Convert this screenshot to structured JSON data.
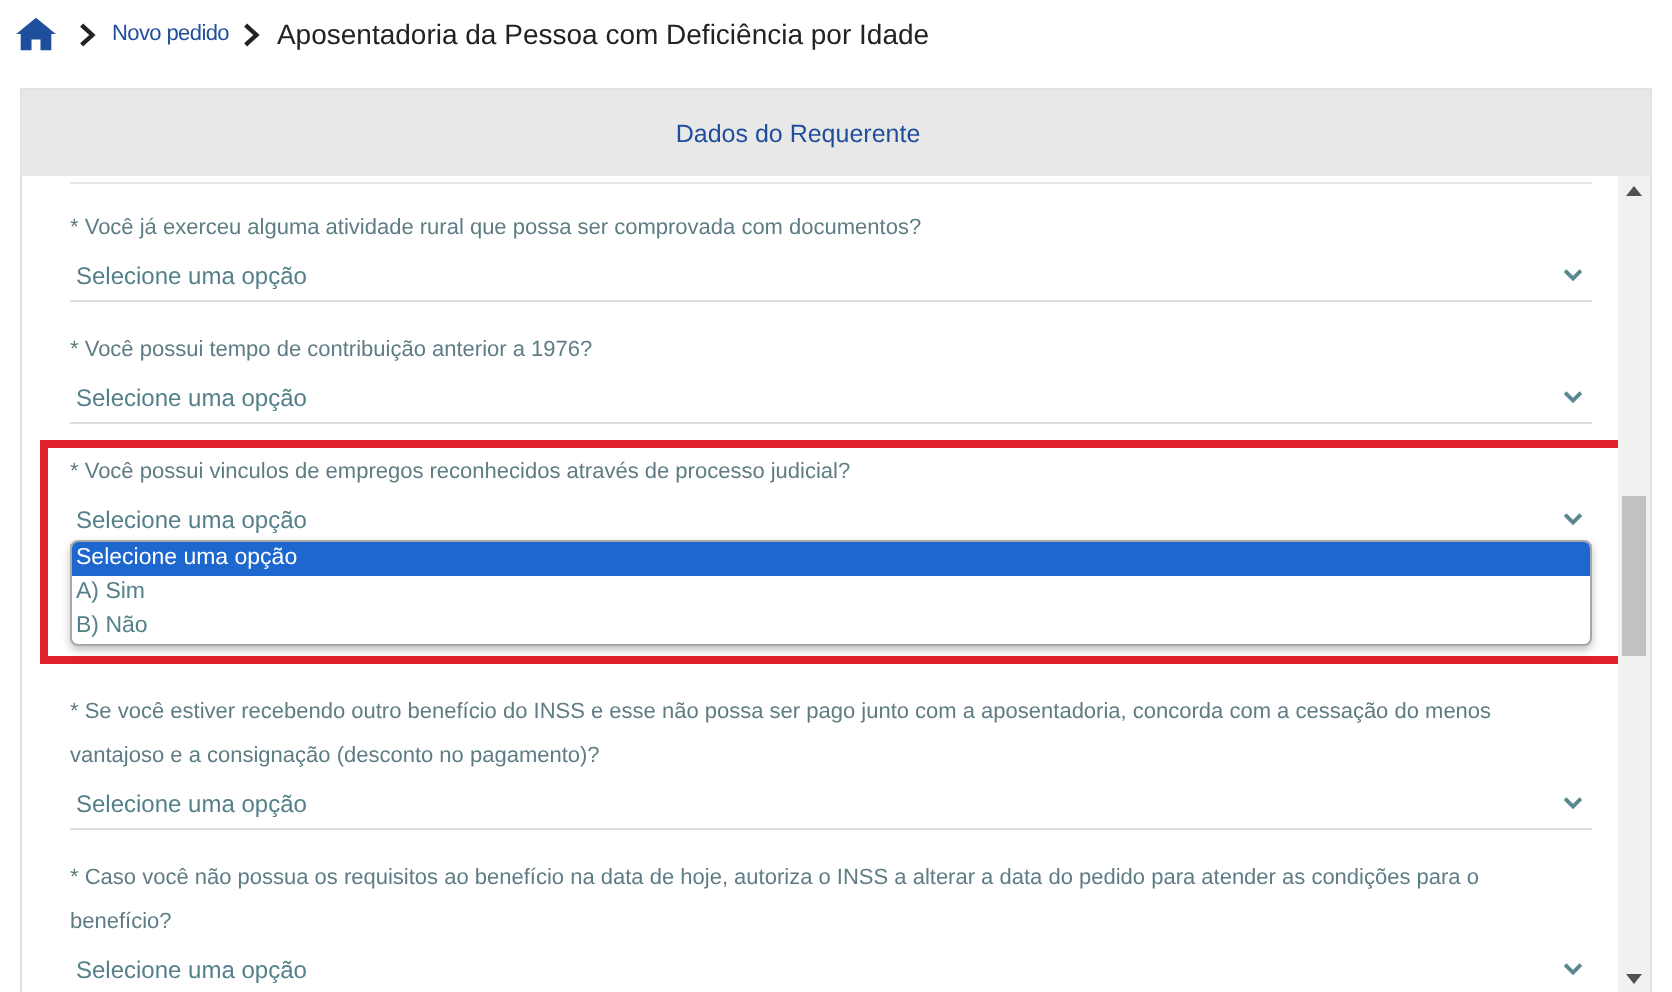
{
  "breadcrumb": {
    "link": "Novo pedido",
    "current": "Aposentadoria da Pessoa com Deficiência por Idade"
  },
  "section": {
    "title": "Dados do Requerente"
  },
  "questions": [
    {
      "label": "* Você já exerceu alguma atividade rural que possa ser comprovada com documentos?",
      "value": "Selecione uma opção",
      "highlighted": false
    },
    {
      "label": "* Você possui tempo de contribuição anterior a 1976?",
      "value": "Selecione uma opção",
      "highlighted": false
    },
    {
      "label": "* Você possui vinculos de empregos reconhecidos através de processo judicial?",
      "value": "Selecione uma opção",
      "highlighted": true,
      "options": [
        {
          "label": "Selecione uma opção",
          "selected": true
        },
        {
          "label": "A) Sim",
          "selected": false
        },
        {
          "label": "B) Não",
          "selected": false
        }
      ]
    },
    {
      "label": "* Se você estiver recebendo outro benefício do INSS e esse não possa ser pago junto com a aposentadoria, concorda com a cessação do menos vantajoso e a consignação (desconto no pagamento)?",
      "value": "Selecione uma opção",
      "highlighted": false
    },
    {
      "label": "* Caso você não possua os requisitos ao benefício na data de hoje, autoriza o INSS a alterar a data do pedido para atender as condições para o benefício?",
      "value": "Selecione uma opção",
      "highlighted": false
    }
  ]
}
